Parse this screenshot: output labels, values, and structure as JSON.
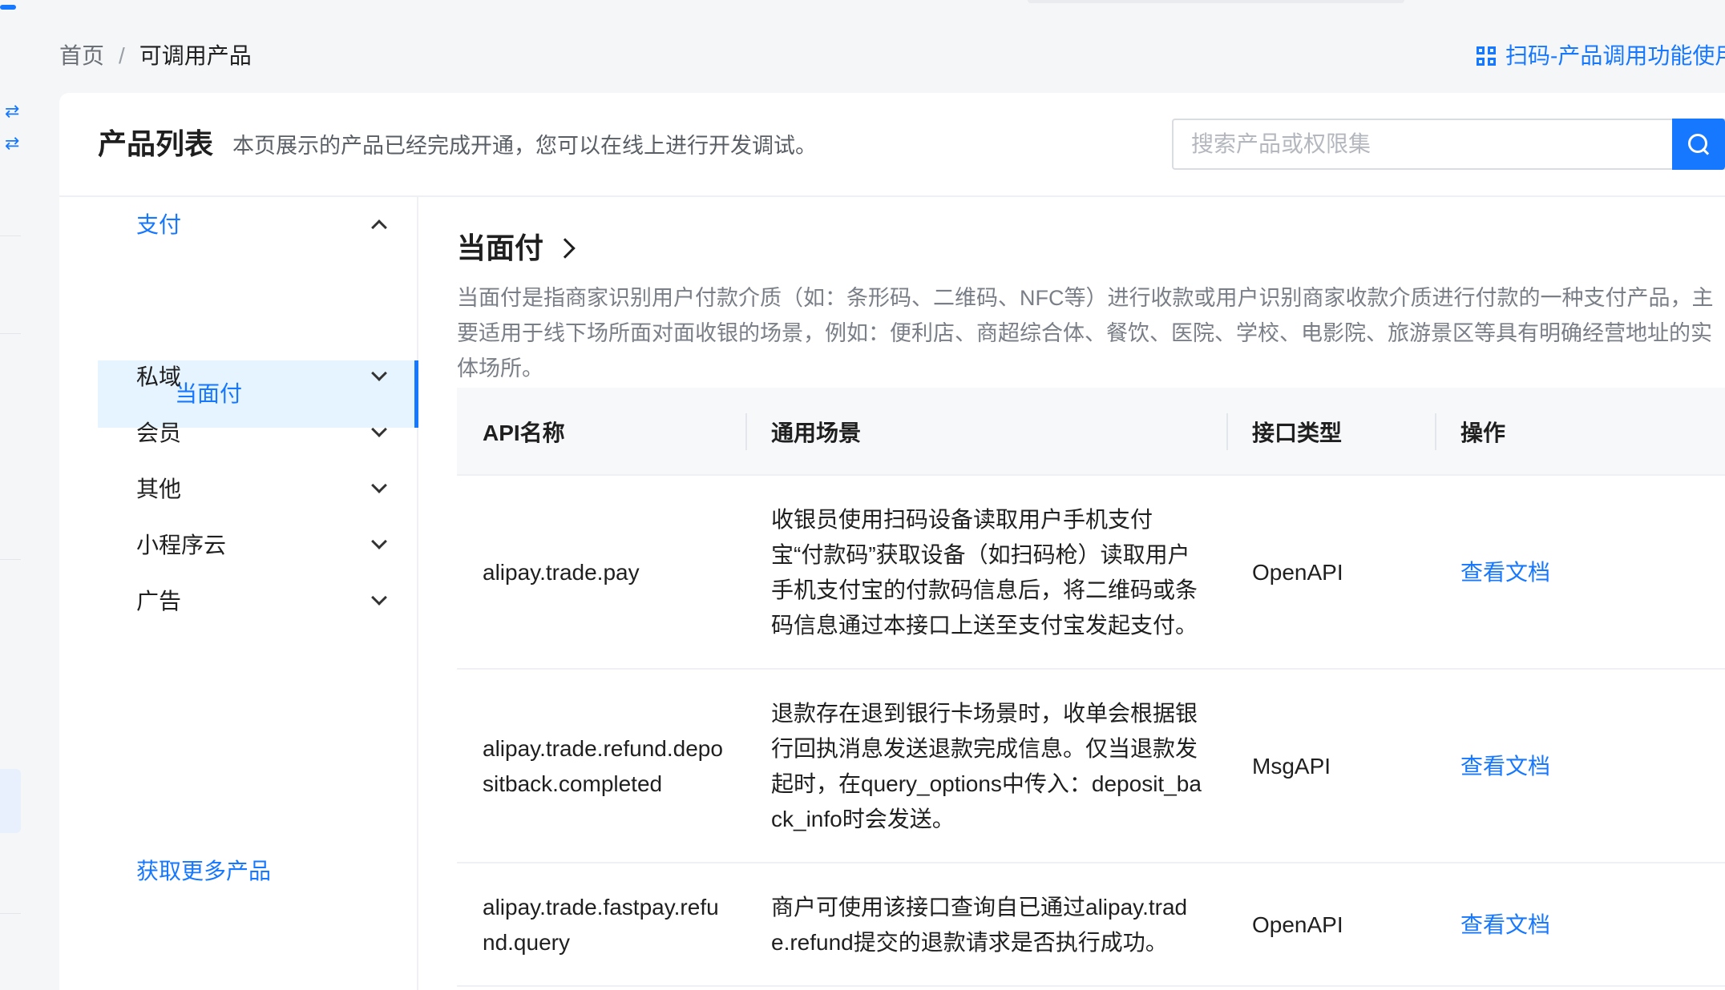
{
  "breadcrumb": {
    "home": "首页",
    "separator": "/",
    "current": "可调用产品"
  },
  "scan_link": {
    "label": "扫码-产品调用功能使用",
    "icon": "qr-code-icon"
  },
  "header": {
    "title": "产品列表",
    "description": "本页展示的产品已经完成开通，您可以在线上进行开发调试。"
  },
  "search": {
    "placeholder": "搜索产品或权限集",
    "value": "",
    "icon": "search-icon"
  },
  "rail": {
    "icons": [
      "swap-icon",
      "swap-icon"
    ]
  },
  "sidebar": {
    "groups": [
      {
        "label": "支付",
        "expanded": true,
        "children": [
          {
            "label": "当面付",
            "selected": true
          }
        ]
      },
      {
        "label": "私域",
        "expanded": false
      },
      {
        "label": "会员",
        "expanded": false
      },
      {
        "label": "其他",
        "expanded": false
      },
      {
        "label": "小程序云",
        "expanded": false
      },
      {
        "label": "广告",
        "expanded": false
      }
    ],
    "more_link": "获取更多产品"
  },
  "product": {
    "title": "当面付",
    "description": "当面付是指商家识别用户付款介质（如：条形码、二维码、NFC等）进行收款或用户识别商家收款介质进行付款的一种支付产品，主要适用于线下场所面对面收银的场景，例如：便利店、商超综合体、餐饮、医院、学校、电影院、旅游景区等具有明确经营地址的实体场所。"
  },
  "table": {
    "columns": [
      "API名称",
      "通用场景",
      "接口类型",
      "操作"
    ],
    "rows": [
      {
        "api": "alipay.trade.pay",
        "scene": "收银员使用扫码设备读取用户手机支付宝“付款码”获取设备（如扫码枪）读取用户手机支付宝的付款码信息后，将二维码或条码信息通过本接口上送至支付宝发起支付。",
        "type": "OpenAPI",
        "action": "查看文档"
      },
      {
        "api": "alipay.trade.refund.depositback.completed",
        "scene": "退款存在退到银行卡场景时，收单会根据银行回执消息发送退款完成信息。仅当退款发起时，在query_options中传入：deposit_back_info时会发送。",
        "type": "MsgAPI",
        "action": "查看文档"
      },
      {
        "api": "alipay.trade.fastpay.refund.query",
        "scene": "商户可使用该接口查询自已通过alipay.trade.refund提交的退款请求是否执行成功。",
        "type": "OpenAPI",
        "action": "查看文档"
      }
    ]
  },
  "colors": {
    "accent": "#1677ff",
    "selected_bg": "#e6f4ff",
    "page_bg": "#f5f6f8"
  }
}
